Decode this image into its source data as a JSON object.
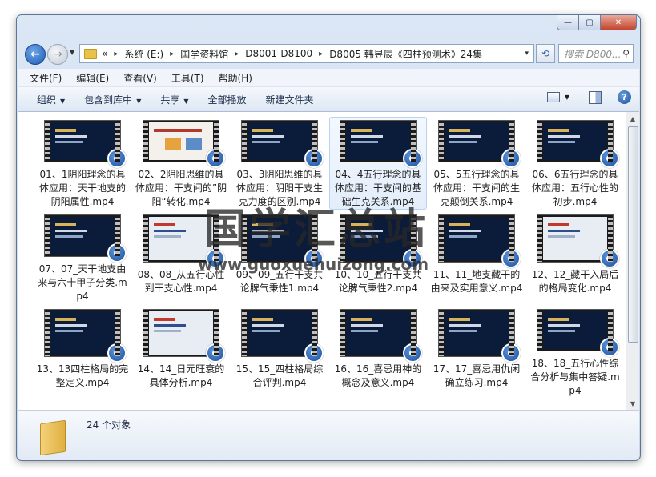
{
  "window": {
    "close_glyph": "✕",
    "max_glyph": "▢",
    "min_glyph": "—"
  },
  "address": {
    "overflow": "«",
    "crumbs": [
      "系统 (E:)",
      "国学资料馆",
      "D8001-D8100",
      "D8005 韩昱辰《四柱预测术》24集"
    ],
    "separator": "▸",
    "dropdown": "▾"
  },
  "search": {
    "placeholder": "搜索 D800...",
    "icon": "search-icon"
  },
  "menu": [
    "文件(F)",
    "编辑(E)",
    "查看(V)",
    "工具(T)",
    "帮助(H)"
  ],
  "toolbar": {
    "organize": "组织",
    "include": "包含到库中",
    "share": "共享",
    "play_all": "全部播放",
    "new_folder": "新建文件夹",
    "dropdown_glyph": "▼",
    "help": "?"
  },
  "files": [
    {
      "name": "01、1阴阳理念的具体应用：天干地支的阴阳属性.mp4",
      "style": "dark"
    },
    {
      "name": "02、2阴阳思维的具体应用：干支间的”阴阳“转化.mp4",
      "style": "slide"
    },
    {
      "name": "03、3阴阳思维的具体应用：阴阳干支生克力度的区别.mp4",
      "style": "dark"
    },
    {
      "name": "04、4五行理念的具体应用：干支间的基础生克关系.mp4",
      "style": "dark"
    },
    {
      "name": "05、5五行理念的具体应用：干支间的生克颠倒关系.mp4",
      "style": "dark"
    },
    {
      "name": "06、6五行理念的具体应用：五行心性的初步.mp4",
      "style": "dark"
    },
    {
      "name": "07、07_天干地支由来与六十甲子分类.mp4",
      "style": "dark"
    },
    {
      "name": "08、08_从五行心性到干支心性.mp4",
      "style": "light"
    },
    {
      "name": "09、09_五行干支共论脾气秉性1.mp4",
      "style": "dark"
    },
    {
      "name": "10、10_五行干支共论脾气秉性2.mp4",
      "style": "dark"
    },
    {
      "name": "11、11_地支藏干的由来及实用意义.mp4",
      "style": "dark"
    },
    {
      "name": "12、12_藏干入局后的格局变化.mp4",
      "style": "light"
    },
    {
      "name": "13、13四柱格局的完整定义.mp4",
      "style": "dark"
    },
    {
      "name": "14、14_日元旺衰的具体分析.mp4",
      "style": "light"
    },
    {
      "name": "15、15_四柱格局综合评判.mp4",
      "style": "dark"
    },
    {
      "name": "16、16_喜忌用神的概念及意义.mp4",
      "style": "dark"
    },
    {
      "name": "17、17_喜忌用仇闲确立练习.mp4",
      "style": "dark"
    },
    {
      "name": "18、18_五行心性综合分析与集中答疑.mp4",
      "style": "dark"
    }
  ],
  "selected_index": 3,
  "watermark": {
    "title": "国学汇总站",
    "url": "www.guoxuehuizong.com"
  },
  "details": {
    "count": "24 个对象"
  }
}
